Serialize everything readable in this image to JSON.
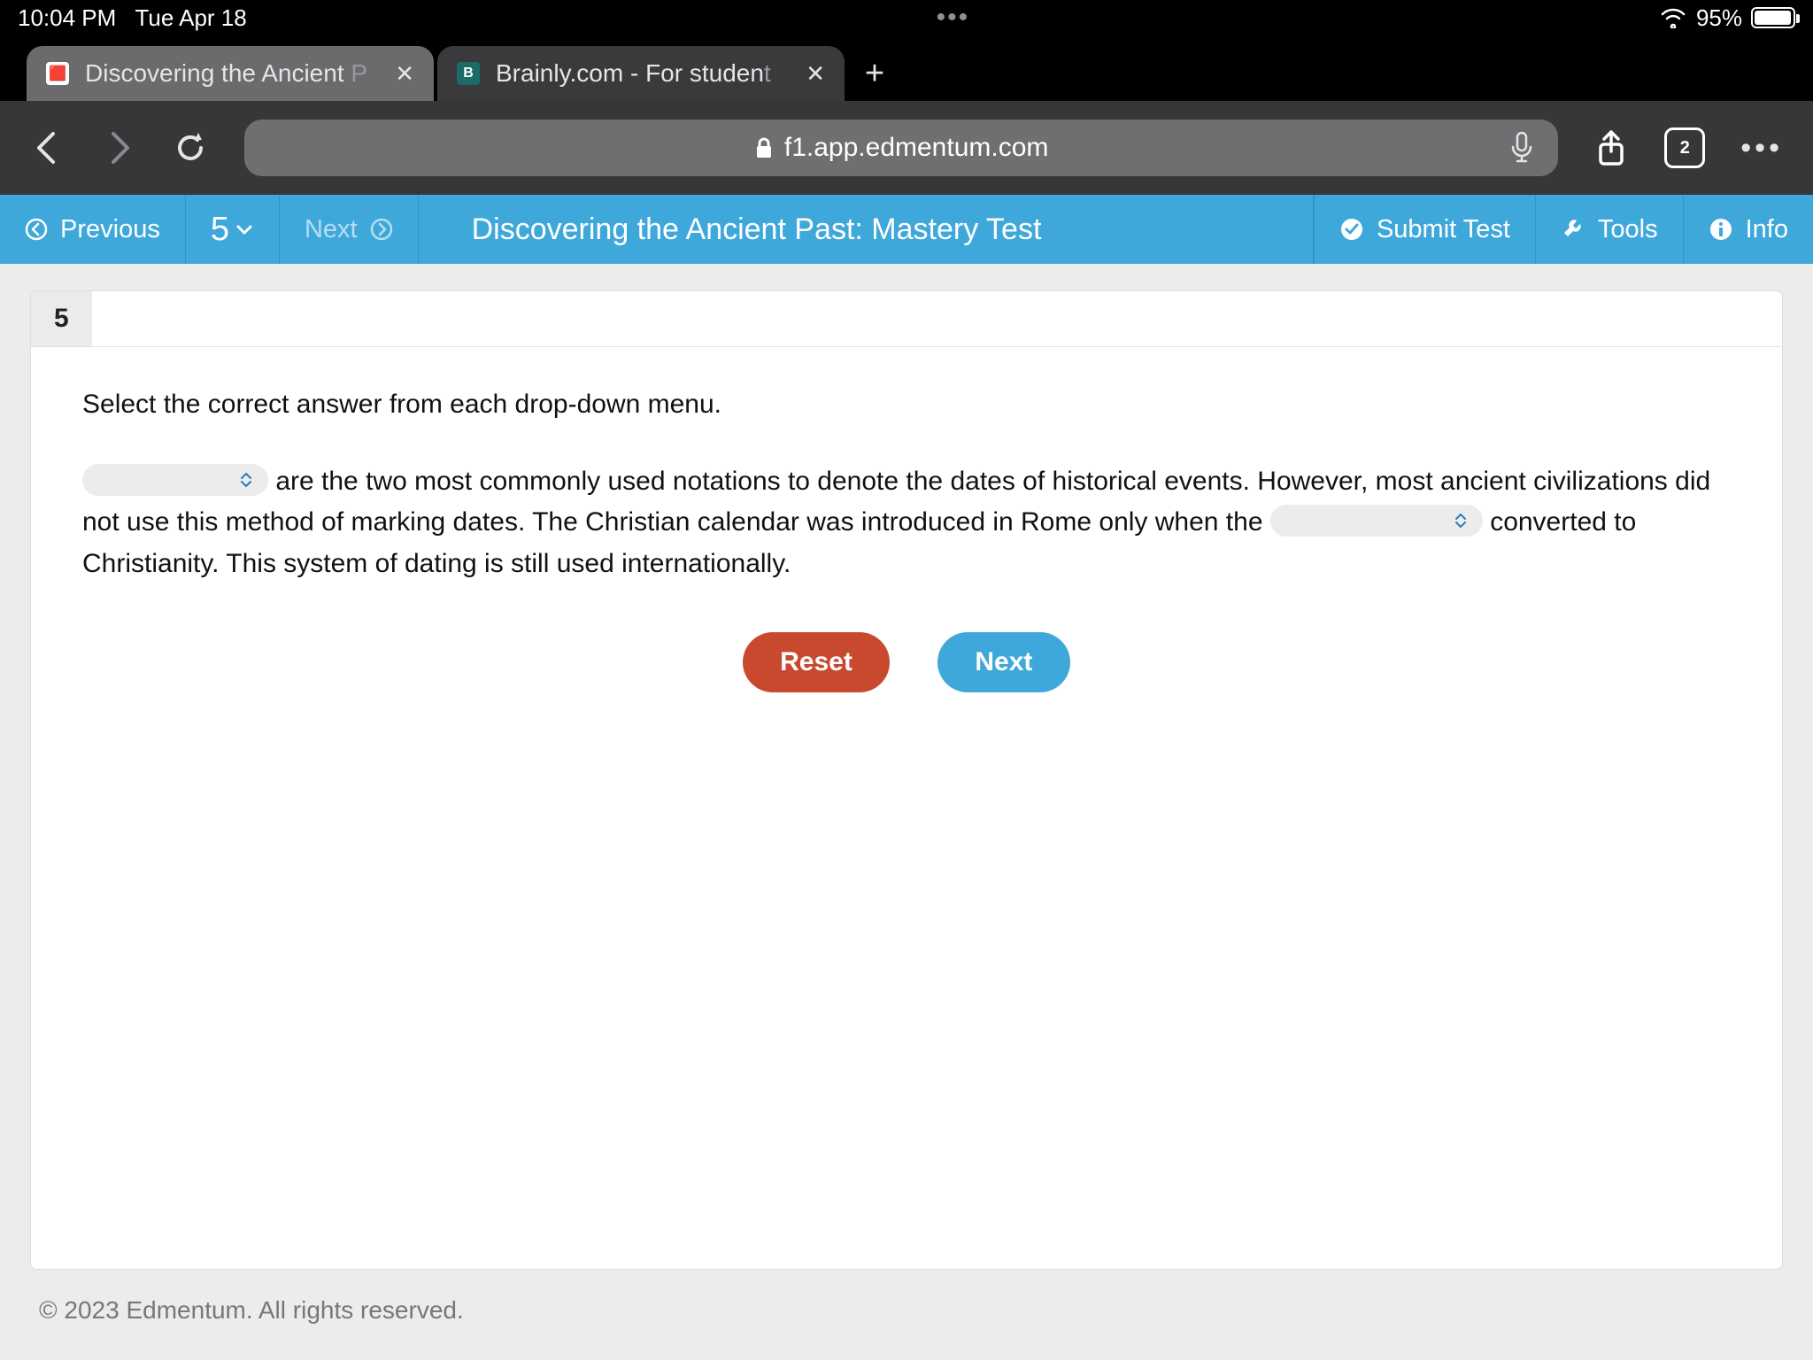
{
  "status": {
    "time": "10:04 PM",
    "date": "Tue Apr 18",
    "battery_pct": "95%"
  },
  "tabs": {
    "active_title": "Discovering the Ancient",
    "active_fade": " P",
    "second_title": "Brainly.com - For studen",
    "second_fade": "t"
  },
  "url": {
    "host": "f1.app.edmentum.com",
    "open_tab_count": "2"
  },
  "appnav": {
    "prev": "Previous",
    "qnum": "5",
    "next": "Next",
    "title": "Discovering the Ancient Past: Mastery Test",
    "submit": "Submit Test",
    "tools": "Tools",
    "info": "Info"
  },
  "question": {
    "number": "5",
    "instruction": "Select the correct answer from each drop-down menu.",
    "seg_a": " are the two most commonly used notations to denote the dates of historical events. However, most ancient civilizations did not use this method of marking dates. The Christian calendar was introduced in Rome only when the ",
    "seg_b": " converted to Christianity. This system of dating is still used internationally.",
    "reset": "Reset",
    "next_btn": "Next"
  },
  "footer": "© 2023 Edmentum. All rights reserved."
}
